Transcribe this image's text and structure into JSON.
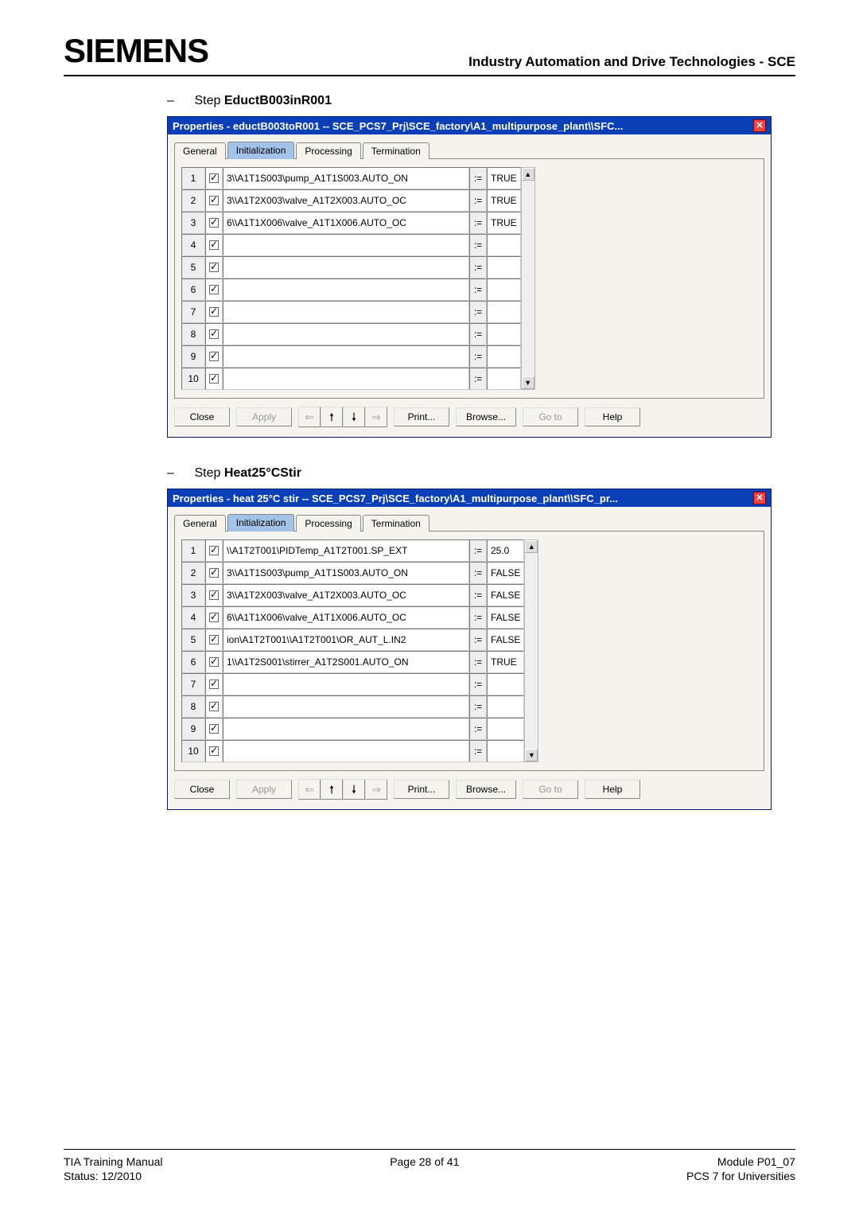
{
  "header": {
    "logo": "SIEMENS",
    "right": "Industry Automation and Drive Technologies - SCE"
  },
  "step1": {
    "label_prefix": "Step ",
    "label_name": "EductB003inR001"
  },
  "step2": {
    "label_prefix": "Step ",
    "label_name": "Heat25°CStir"
  },
  "dialog1": {
    "title": "Properties -  eductB003toR001 -- SCE_PCS7_Prj\\SCE_factory\\A1_multipurpose_plant\\\\SFC...",
    "tabs": {
      "general": "General",
      "initialization": "Initialization",
      "processing": "Processing",
      "termination": "Termination"
    },
    "rows": [
      {
        "n": "1",
        "left": "3\\\\A1T1S003\\pump_A1T1S003.AUTO_ON",
        "right": "TRUE"
      },
      {
        "n": "2",
        "left": "3\\\\A1T2X003\\valve_A1T2X003.AUTO_OC",
        "right": "TRUE"
      },
      {
        "n": "3",
        "left": "6\\\\A1T1X006\\valve_A1T1X006.AUTO_OC",
        "right": "TRUE"
      },
      {
        "n": "4",
        "left": "",
        "right": ""
      },
      {
        "n": "5",
        "left": "",
        "right": ""
      },
      {
        "n": "6",
        "left": "",
        "right": ""
      },
      {
        "n": "7",
        "left": "",
        "right": ""
      },
      {
        "n": "8",
        "left": "",
        "right": ""
      },
      {
        "n": "9",
        "left": "",
        "right": ""
      },
      {
        "n": "10",
        "left": "",
        "right": ""
      }
    ],
    "op": ":=",
    "buttons": {
      "close": "Close",
      "apply": "Apply",
      "print": "Print...",
      "browse": "Browse...",
      "goto": "Go to",
      "help": "Help"
    }
  },
  "dialog2": {
    "title": "Properties -  heat 25°C stir -- SCE_PCS7_Prj\\SCE_factory\\A1_multipurpose_plant\\\\SFC_pr...",
    "tabs": {
      "general": "General",
      "initialization": "Initialization",
      "processing": "Processing",
      "termination": "Termination"
    },
    "rows": [
      {
        "n": "1",
        "left": "\\\\A1T2T001\\PIDTemp_A1T2T001.SP_EXT",
        "right": "25.0"
      },
      {
        "n": "2",
        "left": "3\\\\A1T1S003\\pump_A1T1S003.AUTO_ON",
        "right": "FALSE"
      },
      {
        "n": "3",
        "left": "3\\\\A1T2X003\\valve_A1T2X003.AUTO_OC",
        "right": "FALSE"
      },
      {
        "n": "4",
        "left": "6\\\\A1T1X006\\valve_A1T1X006.AUTO_OC",
        "right": "FALSE"
      },
      {
        "n": "5",
        "left": "ion\\A1T2T001\\\\A1T2T001\\OR_AUT_L.IN2",
        "right": "FALSE"
      },
      {
        "n": "6",
        "left": "1\\\\A1T2S001\\stirrer_A1T2S001.AUTO_ON",
        "right": "TRUE"
      },
      {
        "n": "7",
        "left": "",
        "right": ""
      },
      {
        "n": "8",
        "left": "",
        "right": ""
      },
      {
        "n": "9",
        "left": "",
        "right": ""
      },
      {
        "n": "10",
        "left": "",
        "right": ""
      }
    ],
    "op": ":=",
    "buttons": {
      "close": "Close",
      "apply": "Apply",
      "print": "Print...",
      "browse": "Browse...",
      "goto": "Go to",
      "help": "Help"
    }
  },
  "footer": {
    "left1": "TIA Training Manual",
    "left2": "Status: 12/2010",
    "center": "Page 28 of 41",
    "right1": "Module P01_07",
    "right2": "PCS 7 for Universities"
  }
}
